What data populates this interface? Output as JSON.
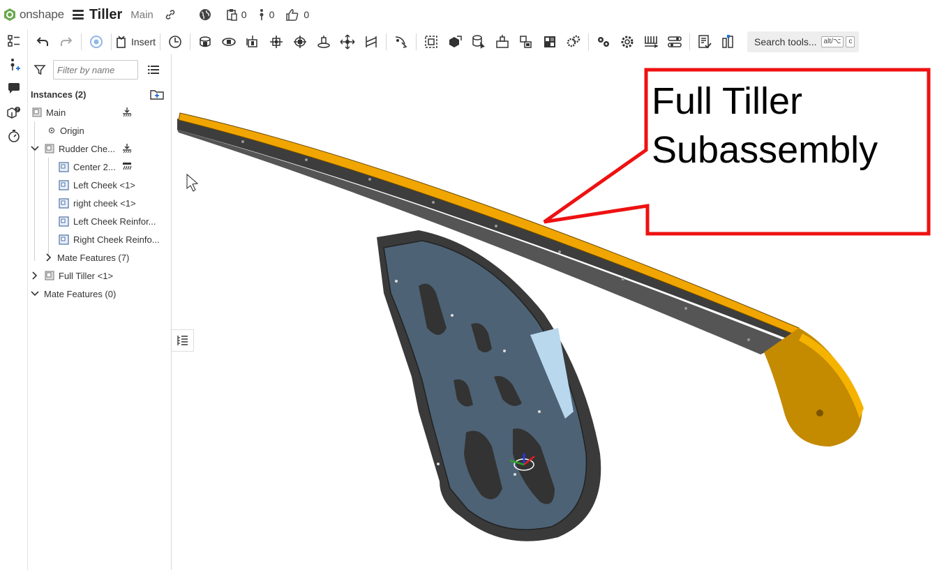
{
  "app": {
    "brand": "onshape",
    "accent": "#6aa84f"
  },
  "document": {
    "title": "Tiller",
    "branch": "Main"
  },
  "topbar": {
    "versions_count": "0",
    "branches_count": "0",
    "likes_count": "0"
  },
  "toolbar": {
    "insert_label": "Insert",
    "search_label": "Search tools...",
    "search_shortcut_1": "alt/⌥",
    "search_shortcut_2": "c"
  },
  "panel": {
    "filter_placeholder": "Filter by name",
    "instances_header": "Instances (2)",
    "items": [
      {
        "label": "Main"
      },
      {
        "label": "Origin"
      },
      {
        "label": "Rudder Che..."
      },
      {
        "label": "Center 2..."
      },
      {
        "label": "Left Cheek <1>"
      },
      {
        "label": "right cheek <1>"
      },
      {
        "label": "Left Cheek Reinfor..."
      },
      {
        "label": "Right Cheek Reinfo..."
      },
      {
        "label": "Mate Features (7)"
      },
      {
        "label": "Full Tiller <1>"
      },
      {
        "label": "Mate Features (0)"
      }
    ]
  },
  "callout": {
    "line1": "Full Tiller",
    "line2": "Subassembly",
    "color": "#ee1111"
  }
}
